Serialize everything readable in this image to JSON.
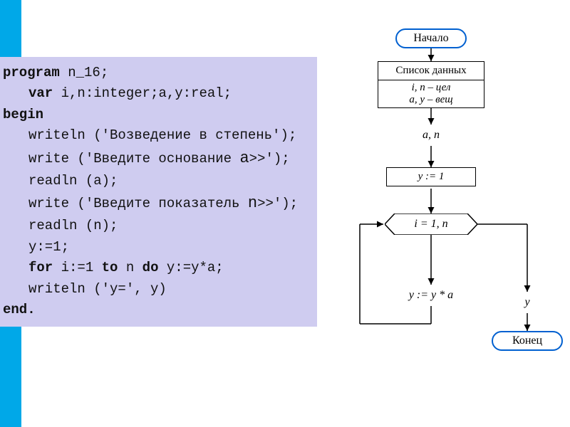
{
  "code": {
    "l1a": "program",
    "l1b": " n_16;",
    "l2a": "var",
    "l2b": " i,n:integer;a,y:real;",
    "l3": "begin",
    "l4": "writeln ('Возведение в степень');",
    "l5a": "write ('Введите основание ",
    "l5b": "a",
    "l5c": ">>');",
    "l6": "readln (a);",
    "l7a": "write ('Введите показатель ",
    "l7b": "n",
    "l7c": ">>');",
    "l8": "readln (n);",
    "l9": "y:=1;",
    "l10a": "for",
    "l10b": " i:=1 ",
    "l10c": "to",
    "l10d": " n ",
    "l10e": "do",
    "l10f": " y:=y*a;",
    "l11": "writeln ('y=', y)",
    "l12": "end."
  },
  "flow": {
    "start": "Начало",
    "data_list": "Список данных",
    "types1": "i, n – цел",
    "types2": "a, y – вещ",
    "input": "a, n",
    "init": "y := 1",
    "loop": "i = 1, n",
    "body": "y := y * a",
    "output": "y",
    "end": "Конец"
  }
}
